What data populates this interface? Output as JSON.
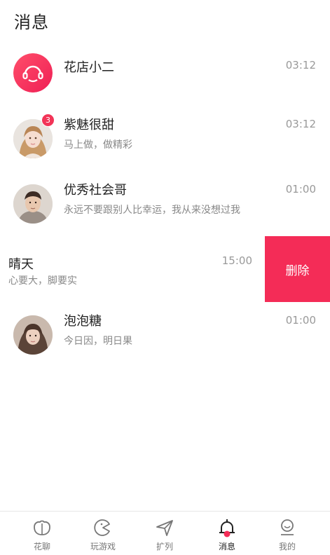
{
  "header": {
    "title": "消息"
  },
  "messages": [
    {
      "name": "花店小二",
      "preview": "",
      "time": "03:12",
      "badge": "",
      "avatar": "headset-icon"
    },
    {
      "name": "紫魅很甜",
      "preview": "马上做，做精彩",
      "time": "03:12",
      "badge": "3",
      "avatar": "user-photo"
    },
    {
      "name": "优秀社会哥",
      "preview": "永远不要跟别人比幸运，我从来没想过我",
      "time": "01:00",
      "badge": "",
      "avatar": "user-photo"
    },
    {
      "name": "晴天",
      "preview": "心要大，脚要实",
      "time": "15:00",
      "badge": "",
      "avatar": "",
      "delete_label": "删除"
    },
    {
      "name": "泡泡糖",
      "preview": "今日因，明日果",
      "time": "01:00",
      "badge": "",
      "avatar": "user-photo"
    }
  ],
  "tabbar": {
    "items": [
      {
        "label": "花聊",
        "icon": "chat-bubble-icon",
        "active": false
      },
      {
        "label": "玩游戏",
        "icon": "game-icon",
        "active": false
      },
      {
        "label": "扩列",
        "icon": "paper-plane-icon",
        "active": false
      },
      {
        "label": "消息",
        "icon": "bell-icon",
        "active": true
      },
      {
        "label": "我的",
        "icon": "profile-icon",
        "active": false
      }
    ]
  },
  "colors": {
    "accent": "#f42c57",
    "badge": "#f23457",
    "text": "#222222",
    "muted": "#888888"
  }
}
